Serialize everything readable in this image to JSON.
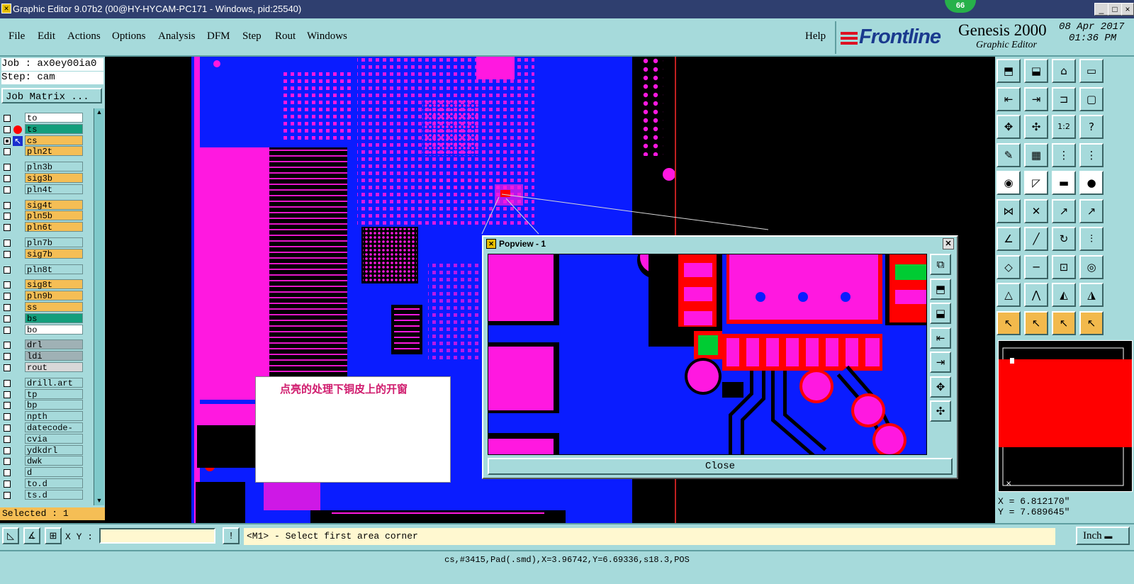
{
  "window": {
    "title": "Graphic Editor 9.07b2 (00@HY-HYCAM-PC171 - Windows, pid:25540)",
    "badge": "66",
    "minimize": "_",
    "maximize": "□",
    "close": "×"
  },
  "menu": {
    "items": [
      "File",
      "Edit",
      "Actions",
      "Options",
      "Analysis",
      "DFM",
      "Step",
      "Rout",
      "Windows"
    ],
    "help": "Help"
  },
  "branding": {
    "logo": "Frontline",
    "product": "Genesis 2000",
    "subtitle": "Graphic Editor",
    "date": "08 Apr 2017",
    "time": "01:36 PM"
  },
  "job": {
    "job_line": "Job : ax0ey00ia0",
    "step_line": "Step: cam",
    "matrix_button": "Job Matrix ..."
  },
  "layers": [
    {
      "name": "to",
      "color": "#ffffff"
    },
    {
      "name": "ts",
      "color": "#149e7c"
    },
    {
      "name": "cs",
      "color": "#f5be55"
    },
    {
      "name": "pln2t",
      "color": "#f5be55"
    },
    {
      "name": "pln3b",
      "color": "#a6dadb"
    },
    {
      "name": "sig3b",
      "color": "#f5be55"
    },
    {
      "name": "pln4t",
      "color": "#a6dadb"
    },
    {
      "name": "sig4t",
      "color": "#f5be55"
    },
    {
      "name": "pln5b",
      "color": "#f5be55"
    },
    {
      "name": "pln6t",
      "color": "#f5be55"
    },
    {
      "name": "pln7b",
      "color": "#a6dadb"
    },
    {
      "name": "sig7b",
      "color": "#f5be55"
    },
    {
      "name": "pln8t",
      "color": "#a6dadb"
    },
    {
      "name": "sig8t",
      "color": "#f5be55"
    },
    {
      "name": "pln9b",
      "color": "#f5be55"
    },
    {
      "name": "ss",
      "color": "#f5be55"
    },
    {
      "name": "bs",
      "color": "#149e7c"
    },
    {
      "name": "bo",
      "color": "#ffffff"
    },
    {
      "name": "drl",
      "color": "#9fb1b5"
    },
    {
      "name": "ldi",
      "color": "#9fb1b5"
    },
    {
      "name": "rout",
      "color": "#d8d8d8"
    },
    {
      "name": "drill.art",
      "color": "#a6dadb"
    },
    {
      "name": "tp",
      "color": "#a6dadb"
    },
    {
      "name": "bp",
      "color": "#a6dadb"
    },
    {
      "name": "npth",
      "color": "#a6dadb"
    },
    {
      "name": "datecode-pte",
      "color": "#a6dadb"
    },
    {
      "name": "cvia",
      "color": "#a6dadb"
    },
    {
      "name": "ydkdrl",
      "color": "#a6dadb"
    },
    {
      "name": "dwk",
      "color": "#a6dadb"
    },
    {
      "name": "d",
      "color": "#a6dadb"
    },
    {
      "name": "to.d",
      "color": "#a6dadb"
    },
    {
      "name": "ts.d",
      "color": "#a6dadb"
    }
  ],
  "selected": "Selected : 1",
  "popview": {
    "title": "Popview - 1",
    "close_label": "Close"
  },
  "annotation": "点亮的处理下铜皮上的开窗",
  "coords": {
    "x": "X = 6.812170\"",
    "y": "Y = 7.689645\""
  },
  "bottom": {
    "xy_label": "X Y :",
    "xy_value": "",
    "prompt": "<M1> - Select first area corner",
    "unit": "Inch"
  },
  "status": "cs,#3415,Pad(.smd),X=3.96742,Y=6.69336,s18.3,POS",
  "colors": {
    "copper": "#ff18e0",
    "plane": "#0a1cff",
    "panel": "#a6dadb",
    "selected_red": "#ff0000",
    "highlight_green": "#00cc33"
  }
}
